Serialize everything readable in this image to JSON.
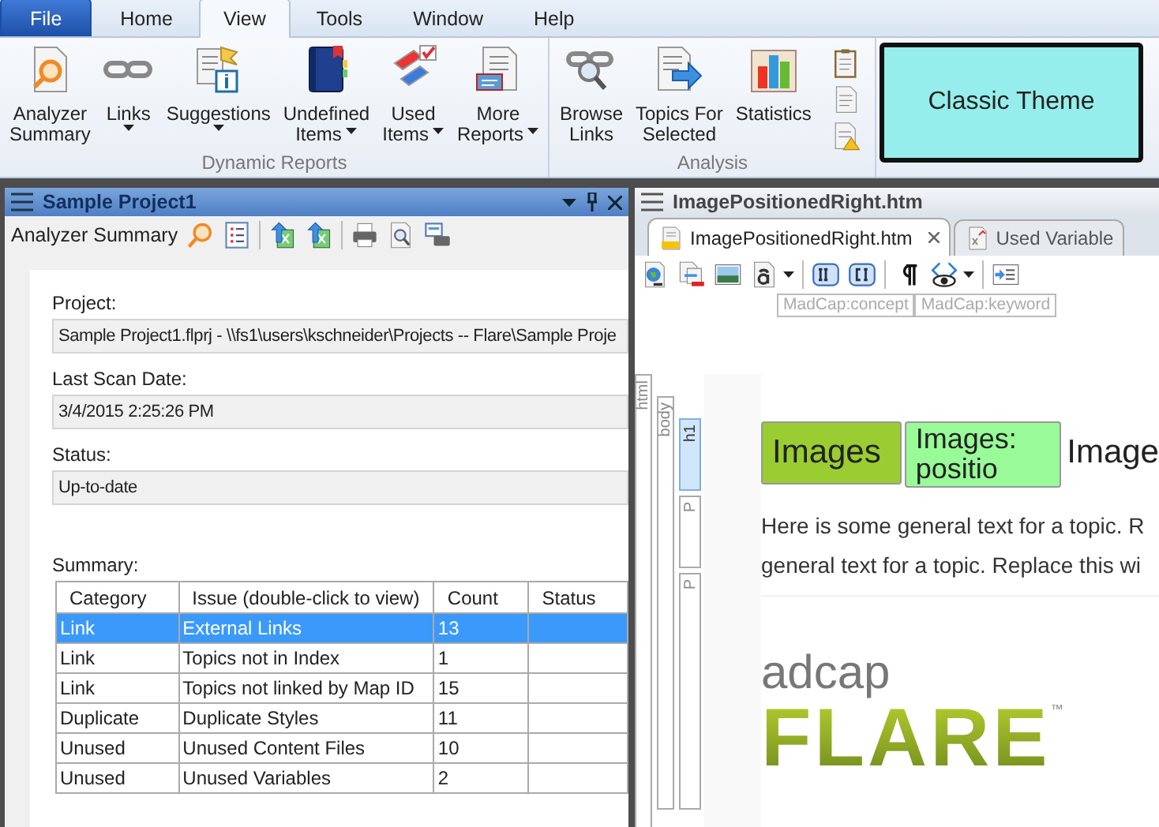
{
  "menu_tabs": [
    {
      "label": "File",
      "kind": "file",
      "selected": false
    },
    {
      "label": "Home",
      "kind": "tab",
      "selected": false
    },
    {
      "label": "View",
      "kind": "tab",
      "selected": true
    },
    {
      "label": "Tools",
      "kind": "tab",
      "selected": false
    },
    {
      "label": "Window",
      "kind": "tab",
      "selected": false
    },
    {
      "label": "Help",
      "kind": "tab",
      "selected": false
    }
  ],
  "ribbon_groups": [
    {
      "label": "Dynamic Reports",
      "buttons": [
        {
          "lines": [
            "Analyzer",
            "Summary"
          ],
          "kind": "doc-magnifier",
          "dropdown": false
        },
        {
          "lines": [
            "Links"
          ],
          "kind": "chain",
          "dropdown": true
        },
        {
          "lines": [
            "Suggestions"
          ],
          "kind": "doc-info",
          "dropdown": true
        },
        {
          "lines": [
            "Undefined",
            "Items"
          ],
          "kind": "book",
          "dropdown": true
        },
        {
          "lines": [
            "Used",
            "Items"
          ],
          "kind": "tags",
          "dropdown": true
        },
        {
          "lines": [
            "More",
            "Reports"
          ],
          "kind": "doc-report",
          "dropdown": true
        }
      ]
    },
    {
      "label": "Analysis",
      "buttons": [
        {
          "lines": [
            "Browse",
            "Links"
          ],
          "kind": "chain-magnifier",
          "dropdown": false
        },
        {
          "lines": [
            "Topics For",
            "Selected"
          ],
          "kind": "doc-arrow",
          "dropdown": false
        },
        {
          "lines": [
            "Statistics"
          ],
          "kind": "bar-chart",
          "dropdown": false
        }
      ],
      "small_buttons": [
        {
          "kind": "clipboard"
        },
        {
          "kind": "doc"
        },
        {
          "kind": "doc-warning"
        }
      ]
    }
  ],
  "overlay": {
    "label": "Classic Theme"
  },
  "left_panel": {
    "title": "Sample Project1",
    "toolbar_title": "Analyzer Summary",
    "toolbar_icons": [
      {
        "kind": "magnifier"
      },
      {
        "kind": "list"
      },
      {
        "kind": "sep"
      },
      {
        "kind": "export"
      },
      {
        "kind": "export-all"
      },
      {
        "kind": "sep"
      },
      {
        "kind": "printer"
      },
      {
        "kind": "preview"
      },
      {
        "kind": "print-setup"
      }
    ],
    "fields": [
      {
        "label": "Project:",
        "value": "Sample Project1.flprj - \\\\fs1\\users\\kschneider\\Projects -- Flare\\Sample Proje"
      },
      {
        "label": "Last Scan Date:",
        "value": "3/4/2015 2:25:26 PM"
      },
      {
        "label": "Status:",
        "value": "Up-to-date"
      }
    ],
    "summary_label": "Summary:",
    "table": {
      "columns": [
        "Category",
        "Issue (double-click to view)",
        "Count",
        "Status"
      ],
      "rows": [
        {
          "cells": [
            "Link",
            "External Links",
            "13",
            ""
          ],
          "selected": true
        },
        {
          "cells": [
            "Link",
            "Topics not in Index",
            "1",
            ""
          ],
          "selected": false
        },
        {
          "cells": [
            "Link",
            "Topics not linked by Map ID",
            "15",
            ""
          ],
          "selected": false
        },
        {
          "cells": [
            "Duplicate",
            "Duplicate Styles",
            "11",
            ""
          ],
          "selected": false
        },
        {
          "cells": [
            "Unused",
            "Unused Content Files",
            "10",
            ""
          ],
          "selected": false
        },
        {
          "cells": [
            "Unused",
            "Unused Variables",
            "2",
            ""
          ],
          "selected": false
        }
      ]
    }
  },
  "right_panel": {
    "title": "ImagePositionedRight.htm",
    "tabs": [
      {
        "label": "ImagePositionedRight.htm",
        "kind": "topic",
        "selected": true,
        "closable": true
      },
      {
        "label": "Used Variable",
        "kind": "report",
        "selected": false,
        "closable": false
      }
    ],
    "toolbar_icons": [
      {
        "kind": "globe-doc"
      },
      {
        "kind": "doc-remove"
      },
      {
        "kind": "image"
      },
      {
        "kind": "font",
        "dropdown": true
      },
      {
        "kind": "sep"
      },
      {
        "kind": "index"
      },
      {
        "kind": "concept"
      },
      {
        "kind": "sep"
      },
      {
        "kind": "pilcrow"
      },
      {
        "kind": "eye",
        "dropdown": true
      },
      {
        "kind": "sep"
      },
      {
        "kind": "insert"
      }
    ],
    "tag_bar": [
      "MadCap:concept",
      "MadCap:keyword"
    ],
    "structure": [
      {
        "label": "html",
        "selected": false,
        "children": [
          {
            "label": "body",
            "selected": false,
            "children": [
              {
                "label": "h1",
                "selected": true
              },
              {
                "label": "P",
                "selected": false
              },
              {
                "label": "P",
                "selected": false
              }
            ]
          }
        ]
      }
    ],
    "heading": [
      {
        "text": "Images",
        "kind": "variable"
      },
      {
        "text": "Images: positio",
        "kind": "snippet"
      },
      {
        "text": "Image",
        "kind": "plain"
      }
    ],
    "paragraph_lines": [
      "Here is some general text for a topic. R",
      "general text for a topic. Replace this wi"
    ],
    "logo": {
      "small": "adcap",
      "large": "FLARE",
      "mark": "™"
    }
  }
}
